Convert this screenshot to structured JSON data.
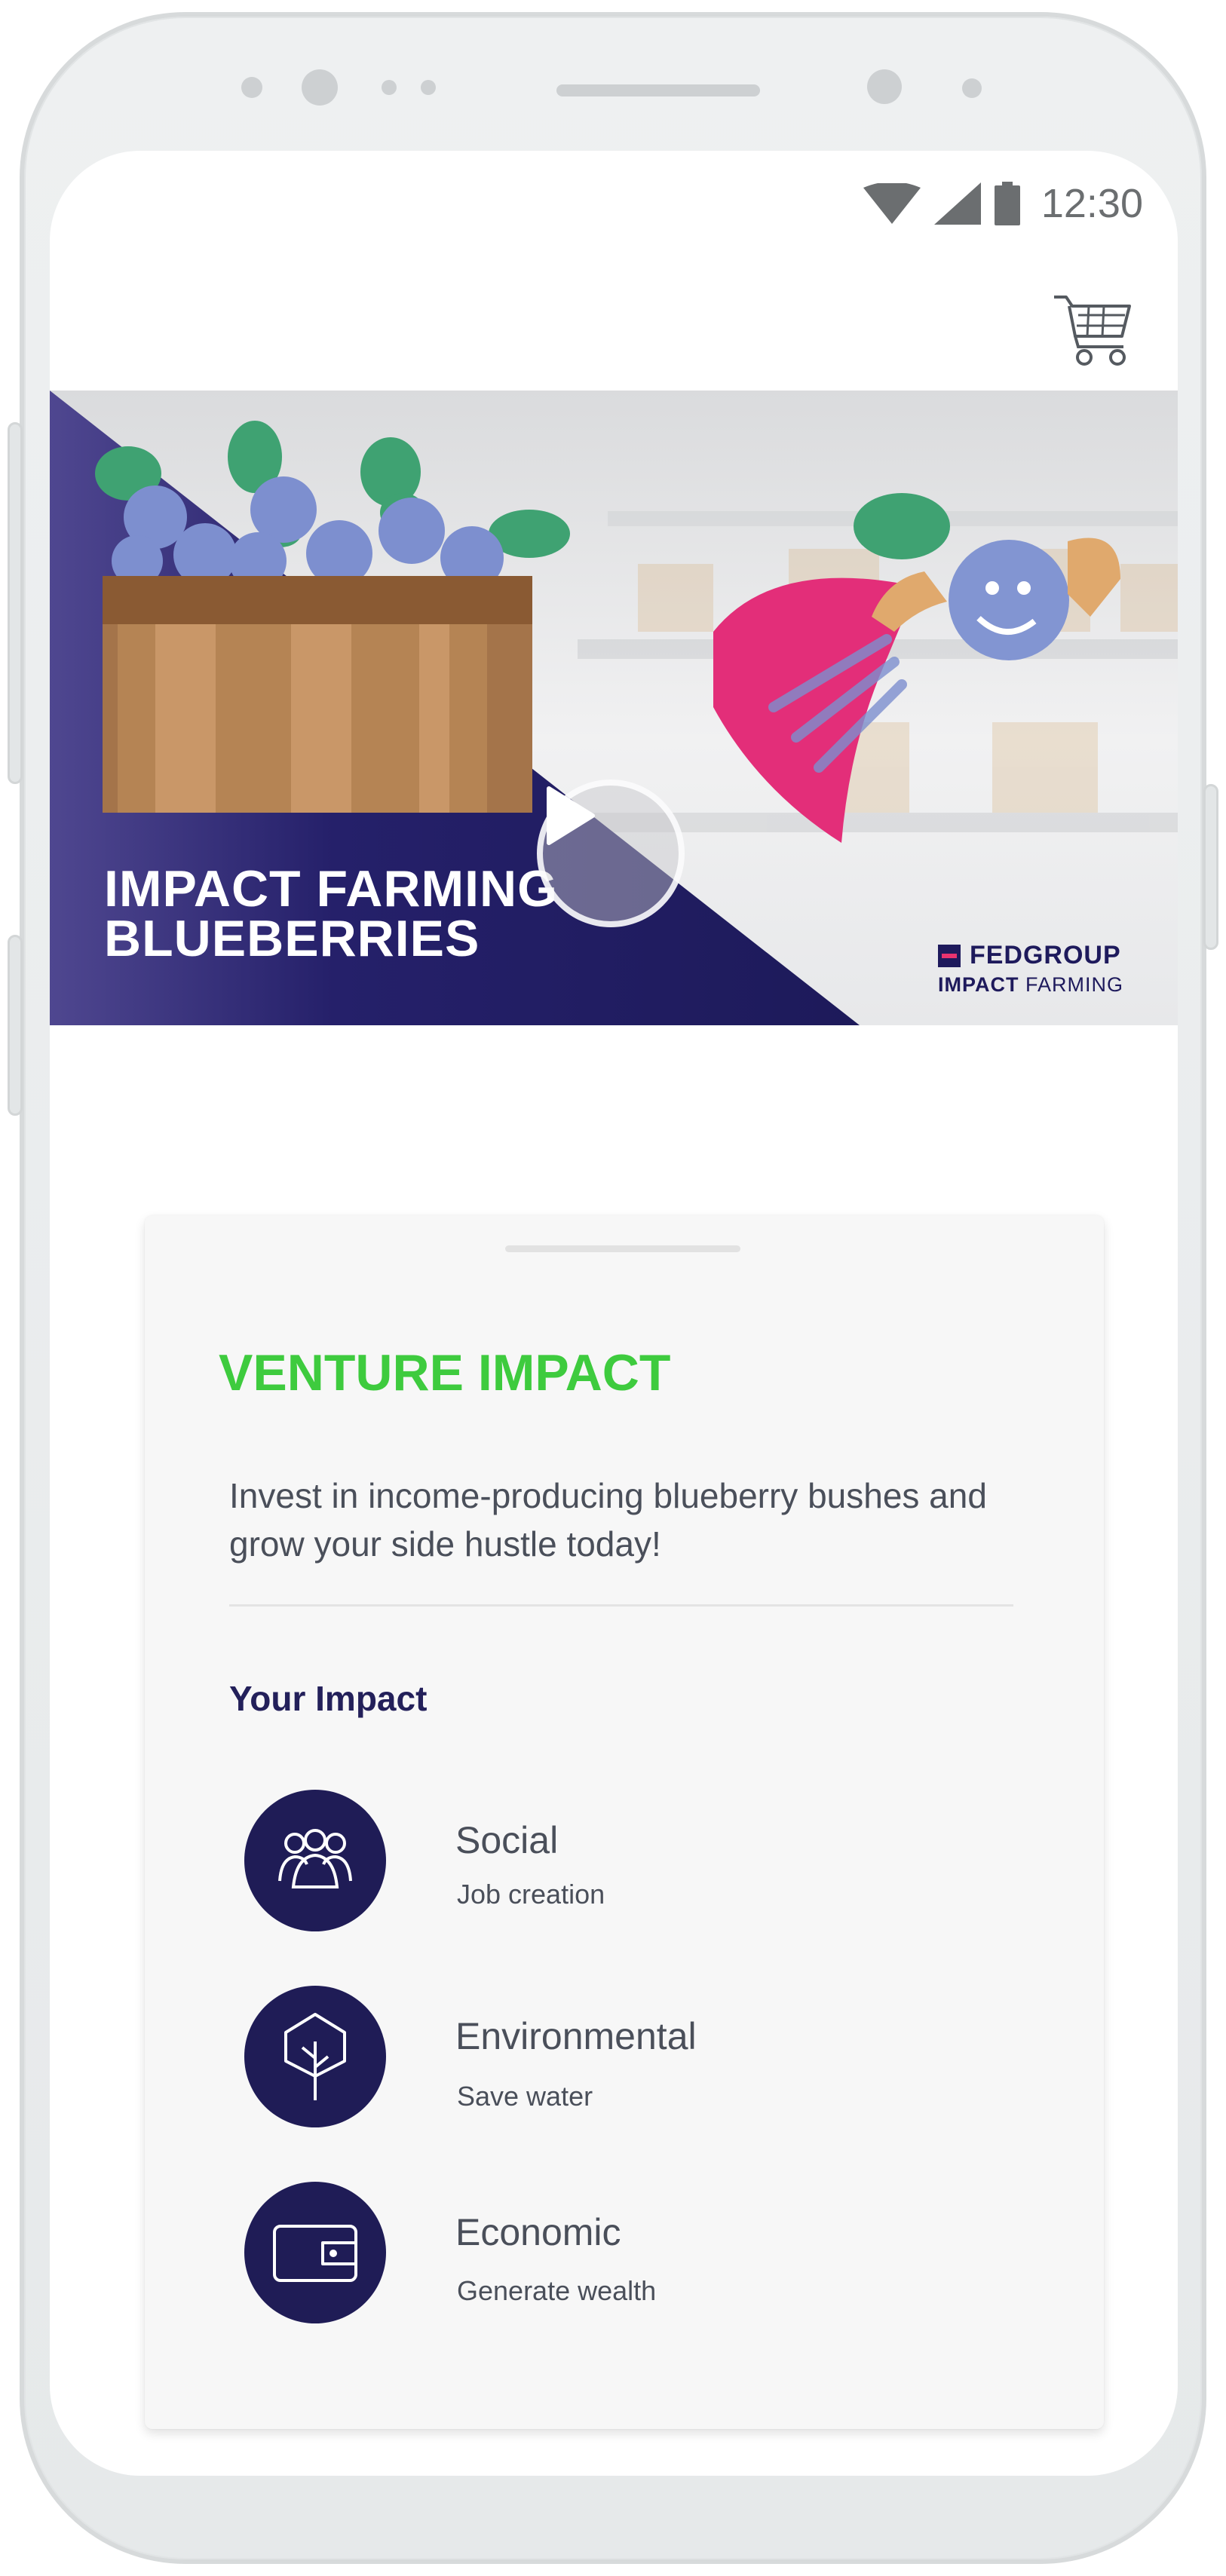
{
  "status_bar": {
    "time": "12:30",
    "icons": [
      "wifi-icon",
      "signal-icon",
      "battery-icon"
    ]
  },
  "header": {
    "cart_icon": "cart-icon"
  },
  "hero": {
    "title_line1": "IMPACT FARMING",
    "title_line2": "BLUEBERRIES",
    "play_icon": "play-icon",
    "brand_name": "FEDGROUP",
    "brand_sub_bold": "IMPACT",
    "brand_sub_rest": " FARMING"
  },
  "card": {
    "title": "VENTURE IMPACT",
    "description": "Invest in income-producing blueberry bushes and grow your side hustle today!",
    "impact_heading": "Your Impact",
    "impacts": [
      {
        "name": "Social",
        "detail": "Job creation",
        "icon": "people-icon"
      },
      {
        "name": "Environmental",
        "detail": "Save water",
        "icon": "tree-icon"
      },
      {
        "name": "Economic",
        "detail": "Generate wealth",
        "icon": "wallet-icon"
      }
    ]
  },
  "colors": {
    "accent_green": "#3ecb3e",
    "navy": "#1f1c56",
    "brand_pink": "#e8336f",
    "text_gray": "#4a4f5a"
  }
}
